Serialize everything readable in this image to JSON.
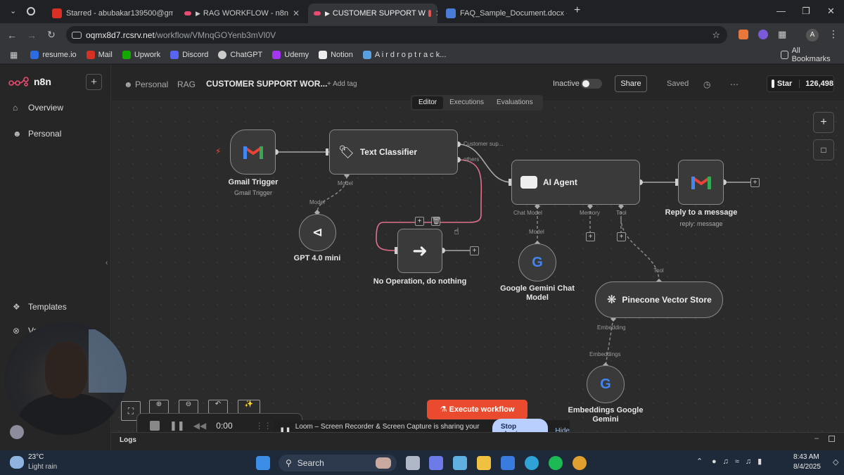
{
  "browser": {
    "tabs": [
      {
        "label": "Starred - abubakar139500@gm",
        "fav": "#d93025"
      },
      {
        "label": "RAG WORKFLOW - n8n",
        "fav": "#ea4b71"
      },
      {
        "label": "CUSTOMER SUPPORT W",
        "fav": "#ea4b71"
      },
      {
        "label": "FAQ_Sample_Document.docx -",
        "fav": "#4a7bd6"
      }
    ],
    "url_host": "oqmx8d7.rcsrv.net",
    "url_path": "/workflow/VMnqGOYenb3mVl0V",
    "bookmarks": [
      "resume.io",
      "Mail",
      "Upwork",
      "Discord",
      "ChatGPT",
      "Udemy",
      "Notion",
      "A i r d r o p t r a c k..."
    ],
    "all_bookmarks": "All Bookmarks",
    "profile_initial": "A"
  },
  "app": {
    "brand": "n8n",
    "sidebar": {
      "overview": "Overview",
      "personal": "Personal",
      "templates": "Templates",
      "variables_partial": "Va"
    },
    "header": {
      "crumb_personal": "Personal",
      "crumb_project": "RAG",
      "workflow_title": "CUSTOMER SUPPORT WOR...",
      "add_tag": "+ Add tag",
      "status": "Inactive",
      "share": "Share",
      "saved": "Saved",
      "star": "Star",
      "star_count": "126,498"
    },
    "view_tabs": {
      "editor": "Editor",
      "executions": "Executions",
      "evaluations": "Evaluations"
    },
    "nodes": {
      "gmail_trigger": {
        "title": "Gmail Trigger",
        "sub": "Gmail Trigger"
      },
      "text_classifier": {
        "title": "Text Classifier",
        "port_model": "Model",
        "out1": "Customer sup...",
        "out2": "others"
      },
      "gpt": {
        "title": "GPT 4.0 mini",
        "port": "Model"
      },
      "noop": {
        "title": "No Operation, do nothing"
      },
      "ai_agent": {
        "title": "AI Agent",
        "port_chat": "Chat Model",
        "port_memory": "Memory",
        "port_tool": "Tool"
      },
      "reply": {
        "title": "Reply to a message",
        "sub": "reply: message"
      },
      "gemini_chat": {
        "title": "Google Gemini Chat Model",
        "port": "Model"
      },
      "pinecone": {
        "title": "Pinecone Vector Store",
        "port_tool": "Tool",
        "port_embedding": "Embedding"
      },
      "embeddings": {
        "title": "Embeddings Google Gemini",
        "port": "Embeddings"
      }
    },
    "execute": "Execute workflow",
    "logs": "Logs"
  },
  "loom": {
    "timer": "0:00",
    "message": "Loom – Screen Recorder & Screen Capture is sharing your screen.",
    "stop": "Stop sharing",
    "hide": "Hide"
  },
  "taskbar": {
    "temp": "23°C",
    "weather": "Light rain",
    "search": "Search",
    "time": "8:43 AM",
    "date": "8/4/2025"
  }
}
